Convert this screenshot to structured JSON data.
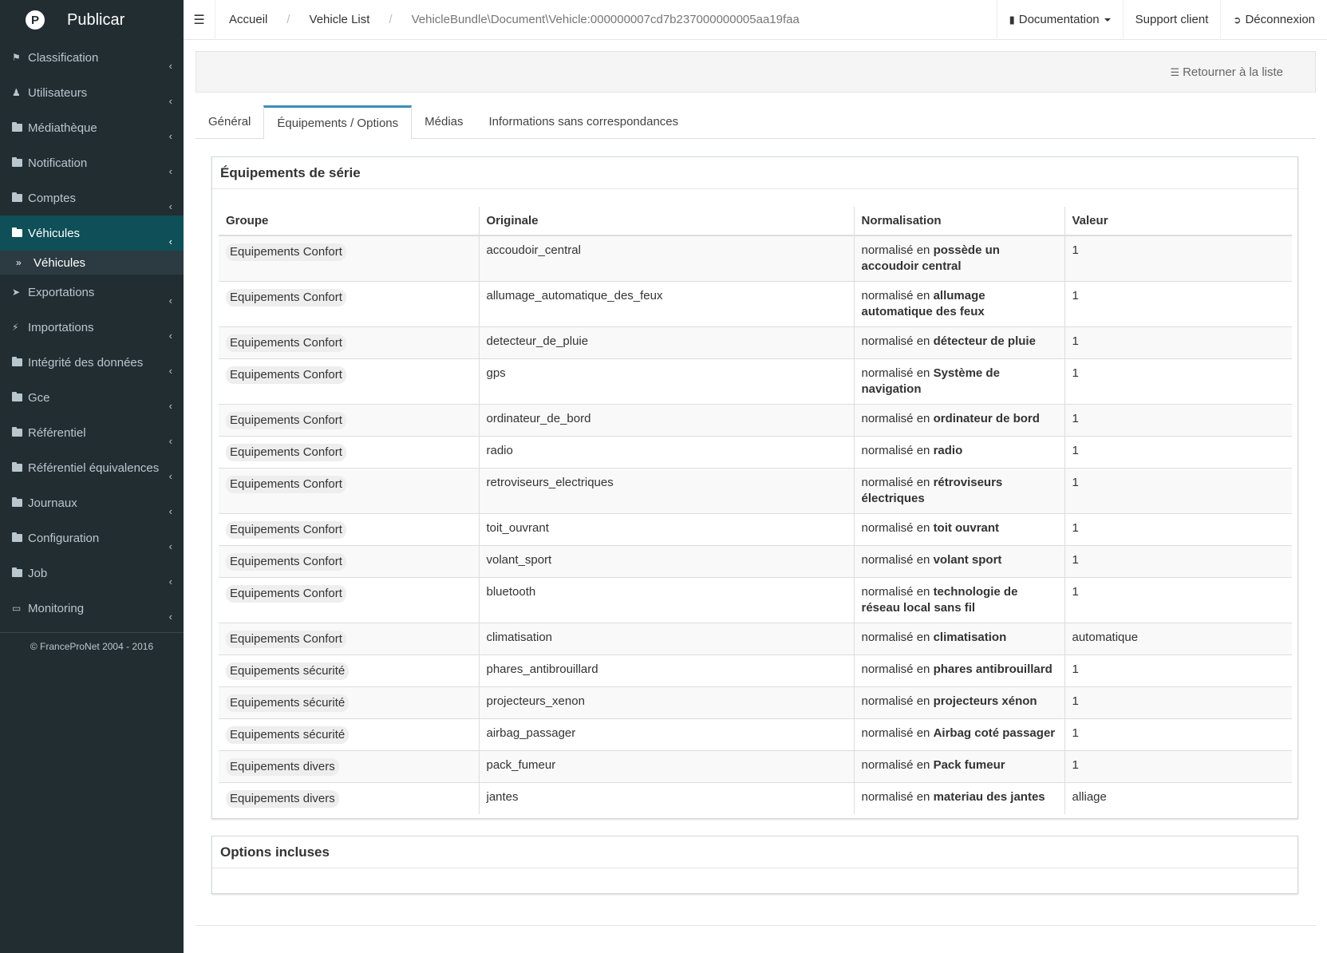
{
  "app": {
    "title": "Publicar",
    "logo": "P"
  },
  "sidebar": {
    "items": [
      {
        "label": "Classification",
        "icon": "tags-icon"
      },
      {
        "label": "Utilisateurs",
        "icon": "users-icon"
      },
      {
        "label": "Médiathèque",
        "icon": "folder-icon"
      },
      {
        "label": "Notification",
        "icon": "folder-icon"
      },
      {
        "label": "Comptes",
        "icon": "folder-icon"
      },
      {
        "label": "Véhicules",
        "icon": "folder-icon"
      },
      {
        "label": "Exportations",
        "icon": "paper-plane-icon"
      },
      {
        "label": "Importations",
        "icon": "bolt-icon"
      },
      {
        "label": "Intégrité des données",
        "icon": "folder-icon"
      },
      {
        "label": "Gce",
        "icon": "folder-icon"
      },
      {
        "label": "Référentiel",
        "icon": "folder-icon"
      },
      {
        "label": "Référentiel équivalences",
        "icon": "folder-icon"
      },
      {
        "label": "Journaux",
        "icon": "folder-icon"
      },
      {
        "label": "Configuration",
        "icon": "folder-icon"
      },
      {
        "label": "Job",
        "icon": "folder-icon"
      },
      {
        "label": "Monitoring",
        "icon": "monitor-icon"
      }
    ],
    "submenu": {
      "label": "Véhicules"
    },
    "footer": "© FranceProNet 2004 - 2016"
  },
  "breadcrumb": {
    "home": "Accueil",
    "list": "Vehicle List",
    "current": "VehicleBundle\\Document\\Vehicle:000000007cd7b237000000005aa19faa",
    "sep": "/"
  },
  "topnav": {
    "documentation": "Documentation",
    "support": "Support client",
    "logout": "Déconnexion"
  },
  "actions": {
    "back": "Retourner à la liste"
  },
  "tabs": [
    "Général",
    "Équipements / Options",
    "Médias",
    "Informations sans correspondances"
  ],
  "box1": {
    "title": "Équipements de série",
    "headers": [
      "Groupe",
      "Originale",
      "Normalisation",
      "Valeur"
    ],
    "norm_prefix": "normalisé en",
    "rows": [
      {
        "groupe": "Equipements Confort",
        "originale": "accoudoir_central",
        "norm": "possède un accoudoir central",
        "valeur": "1"
      },
      {
        "groupe": "Equipements Confort",
        "originale": "allumage_automatique_des_feux",
        "norm": "allumage automatique des feux",
        "valeur": "1"
      },
      {
        "groupe": "Equipements Confort",
        "originale": "detecteur_de_pluie",
        "norm": "détecteur de pluie",
        "valeur": "1"
      },
      {
        "groupe": "Equipements Confort",
        "originale": "gps",
        "norm": "Système de navigation",
        "valeur": "1"
      },
      {
        "groupe": "Equipements Confort",
        "originale": "ordinateur_de_bord",
        "norm": "ordinateur de bord",
        "valeur": "1"
      },
      {
        "groupe": "Equipements Confort",
        "originale": "radio",
        "norm": "radio",
        "valeur": "1"
      },
      {
        "groupe": "Equipements Confort",
        "originale": "retroviseurs_electriques",
        "norm": "rétroviseurs électriques",
        "valeur": "1"
      },
      {
        "groupe": "Equipements Confort",
        "originale": "toit_ouvrant",
        "norm": "toit ouvrant",
        "valeur": "1"
      },
      {
        "groupe": "Equipements Confort",
        "originale": "volant_sport",
        "norm": "volant sport",
        "valeur": "1"
      },
      {
        "groupe": "Equipements Confort",
        "originale": "bluetooth",
        "norm": "technologie de réseau local sans fil",
        "valeur": "1"
      },
      {
        "groupe": "Equipements Confort",
        "originale": "climatisation",
        "norm": "climatisation",
        "valeur": "automatique"
      },
      {
        "groupe": "Equipements sécurité",
        "originale": "phares_antibrouillard",
        "norm": "phares antibrouillard",
        "valeur": "1"
      },
      {
        "groupe": "Equipements sécurité",
        "originale": "projecteurs_xenon",
        "norm": "projecteurs xénon",
        "valeur": "1"
      },
      {
        "groupe": "Equipements sécurité",
        "originale": "airbag_passager",
        "norm": "Airbag coté passager",
        "valeur": "1"
      },
      {
        "groupe": "Equipements divers",
        "originale": "pack_fumeur",
        "norm": "Pack fumeur",
        "valeur": "1"
      },
      {
        "groupe": "Equipements divers",
        "originale": "jantes",
        "norm": "materiau des jantes",
        "valeur": "alliage"
      }
    ]
  },
  "box2": {
    "title": "Options incluses"
  }
}
